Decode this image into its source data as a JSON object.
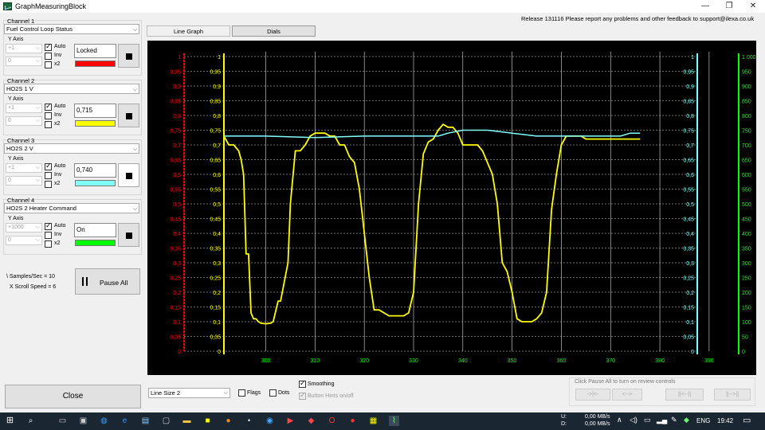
{
  "window": {
    "title": "GraphMeasuringBlock",
    "min": "—",
    "max": "❐",
    "close": "✕"
  },
  "release_text": "Release 131116 Please report any problems and other feedback to support@ilexa.co.uk",
  "tabs": [
    {
      "label": "Line Graph"
    },
    {
      "label": "Dials"
    }
  ],
  "channels": [
    {
      "label": "Channel 1",
      "pid": "Fuel Control Loop Status",
      "yaxis_label": "Y Axis",
      "scale": "+1",
      "offset": "0",
      "auto": true,
      "inv": false,
      "x2": false,
      "auto_label": "Auto",
      "inv_label": "Inv",
      "x2_label": "x2",
      "value": "Locked",
      "color": "#ff0000"
    },
    {
      "label": "Channel 2",
      "pid": "HO2S 1  V",
      "yaxis_label": "Y Axis",
      "scale": "+1",
      "offset": "0",
      "auto": true,
      "inv": false,
      "x2": false,
      "auto_label": "Auto",
      "inv_label": "Inv",
      "x2_label": "x2",
      "value": "0,715",
      "color": "#ffff00"
    },
    {
      "label": "Channel 3",
      "pid": "HO2S 2  V",
      "yaxis_label": "Y Axis",
      "scale": "+1",
      "offset": "0",
      "auto": true,
      "inv": false,
      "x2": false,
      "auto_label": "Auto",
      "inv_label": "Inv",
      "x2_label": "x2",
      "value": "0,740",
      "color": "#80ffff"
    },
    {
      "label": "Channel 4",
      "pid": "HO2S 2 Heater Command",
      "yaxis_label": "Y Axis",
      "scale": "+1000",
      "offset": "0",
      "auto": true,
      "inv": false,
      "x2": false,
      "auto_label": "Auto",
      "inv_label": "Inv",
      "x2_label": "x2",
      "value": "On",
      "color": "#00ff00"
    }
  ],
  "samples_per_sec": "\\ Samples/Sec = 10",
  "scroll_speed": "X Scroll Speed = 6",
  "pause_label": "Pause All",
  "close_label": "Close",
  "line_size": "Line Size 2",
  "flags_label": "Flags",
  "dots_label": "Dots",
  "smoothing_label": "Smoothing",
  "smoothing_checked": true,
  "button_hints_label": "Button Hints on/off",
  "button_hints_checked": true,
  "review_label": "Click Pause All to turn on review controls",
  "review_buttons": [
    "->|<-",
    "<-->",
    "||<--||",
    "||-->||"
  ],
  "taskbar": {
    "up": "U:",
    "down": "D:",
    "up_rate": "0,00 MB/s",
    "down_rate": "0,00 MB/s",
    "lang": "ENG",
    "time": "19:42"
  },
  "chart_data": {
    "type": "line",
    "x_ticks": [
      "300",
      "310",
      "320",
      "330",
      "340",
      "350",
      "360",
      "370",
      "380",
      "390"
    ],
    "xlim": [
      291.5,
      391.8
    ],
    "left_red_axis": {
      "ticks": [
        "1",
        "0,95",
        "0,9",
        "0,85",
        "0,8",
        "0,75",
        "0,7",
        "0,65",
        "0,6",
        "0,55",
        "0,5",
        "0,45",
        "0,4",
        "0,35",
        "0,3",
        "0,25",
        "0,2",
        "0,15",
        "0,1",
        "0,05",
        "0"
      ],
      "color": "#ff0000"
    },
    "left_yellow_axis": {
      "ticks": [
        "1",
        "0,95",
        "0,9",
        "0,85",
        "0,8",
        "0,75",
        "0,7",
        "0,65",
        "0,6",
        "0,55",
        "0,5",
        "0,45",
        "0,4",
        "0,35",
        "0,3",
        "0,25",
        "0,2",
        "0,15",
        "0,1",
        "0,05",
        "0"
      ],
      "color": "#ffff00"
    },
    "right_cyan_axis": {
      "ticks": [
        "1",
        "0,95",
        "0,9",
        "0,85",
        "0,8",
        "0,75",
        "0,7",
        "0,65",
        "0,6",
        "0,55",
        "0,5",
        "0,45",
        "0,4",
        "0,35",
        "0,3",
        "0,25",
        "0,2",
        "0,15",
        "0,1",
        "0,05",
        "0"
      ],
      "color": "#80ffff"
    },
    "right_green_axis": {
      "ticks": [
        "1 000",
        "950",
        "900",
        "850",
        "800",
        "750",
        "700",
        "650",
        "600",
        "550",
        "500",
        "450",
        "400",
        "350",
        "300",
        "250",
        "200",
        "150",
        "100",
        "50",
        "0"
      ],
      "color": "#00ff00"
    },
    "ylim": [
      0,
      1
    ],
    "series": [
      {
        "color": "#ffff00",
        "x": [
          291.5,
          292.5,
          293.5,
          294.5,
          295,
          295.5,
          296,
          296.5,
          297,
          297.5,
          298,
          298.5,
          299,
          300,
          301,
          301.5,
          302.5,
          303,
          304.5,
          305,
          306,
          307,
          308,
          309,
          310,
          311,
          312,
          313,
          314,
          315,
          316,
          317,
          318,
          319,
          320,
          321,
          322,
          323,
          324,
          325,
          326,
          327,
          328,
          329,
          330,
          331,
          332,
          333,
          334,
          335,
          336,
          337,
          338,
          339,
          340,
          341,
          342,
          343,
          344,
          345,
          346,
          347,
          348,
          349,
          350,
          351,
          352,
          353,
          354,
          355,
          356,
          357,
          358,
          359,
          360,
          361,
          362,
          363,
          364,
          365,
          366,
          367,
          368,
          369,
          370,
          371,
          372,
          373,
          374,
          375,
          376
        ],
        "y": [
          0.73,
          0.7,
          0.7,
          0.68,
          0.65,
          0.6,
          0.33,
          0.33,
          0.13,
          0.11,
          0.11,
          0.1,
          0.095,
          0.093,
          0.095,
          0.1,
          0.17,
          0.17,
          0.3,
          0.5,
          0.68,
          0.68,
          0.7,
          0.73,
          0.74,
          0.74,
          0.74,
          0.73,
          0.73,
          0.7,
          0.7,
          0.66,
          0.64,
          0.55,
          0.4,
          0.25,
          0.14,
          0.14,
          0.13,
          0.12,
          0.12,
          0.12,
          0.12,
          0.13,
          0.2,
          0.5,
          0.67,
          0.71,
          0.72,
          0.75,
          0.77,
          0.76,
          0.76,
          0.74,
          0.7,
          0.7,
          0.7,
          0.7,
          0.68,
          0.64,
          0.6,
          0.5,
          0.3,
          0.27,
          0.2,
          0.11,
          0.1,
          0.1,
          0.1,
          0.11,
          0.13,
          0.2,
          0.48,
          0.6,
          0.7,
          0.73,
          0.73,
          0.73,
          0.73,
          0.72,
          0.72,
          0.72,
          0.72,
          0.72,
          0.72,
          0.72,
          0.72,
          0.72,
          0.72,
          0.72,
          0.72
        ]
      },
      {
        "color": "#80ffff",
        "x": [
          291.5,
          300,
          310,
          320,
          330,
          335,
          337,
          340,
          345,
          350,
          355,
          360,
          365,
          370,
          372,
          374,
          376
        ],
        "y": [
          0.73,
          0.73,
          0.725,
          0.73,
          0.73,
          0.73,
          0.74,
          0.75,
          0.75,
          0.74,
          0.73,
          0.73,
          0.73,
          0.73,
          0.73,
          0.74,
          0.74
        ]
      }
    ],
    "grid": true
  }
}
